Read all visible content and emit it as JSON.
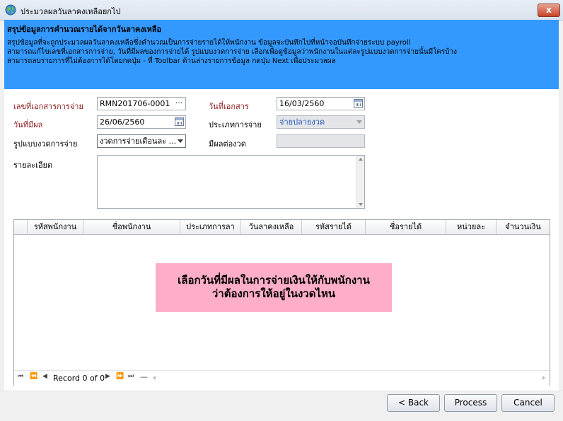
{
  "window": {
    "title": "ประมวลผลวันลาคงเหลือยกไป",
    "close_label": "x"
  },
  "banner": {
    "title": "สรุปข้อมูลการคำนวณรายได้จากวันลาคงเหลือ",
    "line1": "สรุปข้อมูลที่จะถูกประมวลผลวันลาคงเหลือซึ่งคำนวณเป็นการจ่ายรายได้ให้พนักงาน ข้อมูลจะบันทึกไปที่หน้าจอบันทึกจ่ายระบบ payroll",
    "line2": "สามารถแก้ไขเลขที่เอกสารการจ่าย, วันที่มีผลของการจ่ายได้ รูปแบบงวดการจ่าย เลือกเพื่อดูข้อมูลว่าพนักงานในแต่ละรูปแบบงวดการจ่ายนั้นมีใครบ้าง",
    "line3": "สามารถลบรายการที่ไม่ต้องการได้โดยกดปุ่ม - ที่ Toolbar ด้านล่างรายการข้อมูล กดปุ่ม Next เพื่อประมวลผล"
  },
  "form": {
    "doc_no_label": "เลขที่เอกสารการจ่าย",
    "doc_no_value": "RMN201706-0001",
    "doc_no_button": "···",
    "doc_date_label": "วันที่เอกสาร",
    "doc_date_value": "16/03/2560",
    "effective_date_label": "วันที่มีผล",
    "effective_date_value": "26/06/2560",
    "pay_type_label": "ประเภทการจ่าย",
    "pay_type_value": "จ่ายปลายงวด",
    "period_format_label": "รูปแบบงวดการจ่าย",
    "period_format_value": "งวดการจ่ายเดือนละ ...",
    "effective_period_label": "มีผลต่องวด",
    "effective_period_value": "",
    "details_label": "รายละเอียด",
    "details_value": ""
  },
  "grid": {
    "columns": [
      "รหัสพนักงาน",
      "ชื่อพนักงาน",
      "ประเภทการลา",
      "วันลาคงเหลือ",
      "รหัสรายได้",
      "ชื่อรายได้",
      "หน่วยละ",
      "จำนวนเงิน"
    ],
    "notice_line1": "เลือกวันที่มีผลในการจ่ายเงินให้กับพนักงาน",
    "notice_line2": "ว่าต้องการให้อยู่ในงวดไหน",
    "record_text": "Record 0 of 0"
  },
  "buttons": {
    "back": "< Back",
    "process": "Process",
    "cancel": "Cancel"
  },
  "colors": {
    "banner": "#3399ff",
    "notice": "#ffaec9",
    "required_label": "#8b1a1a"
  }
}
